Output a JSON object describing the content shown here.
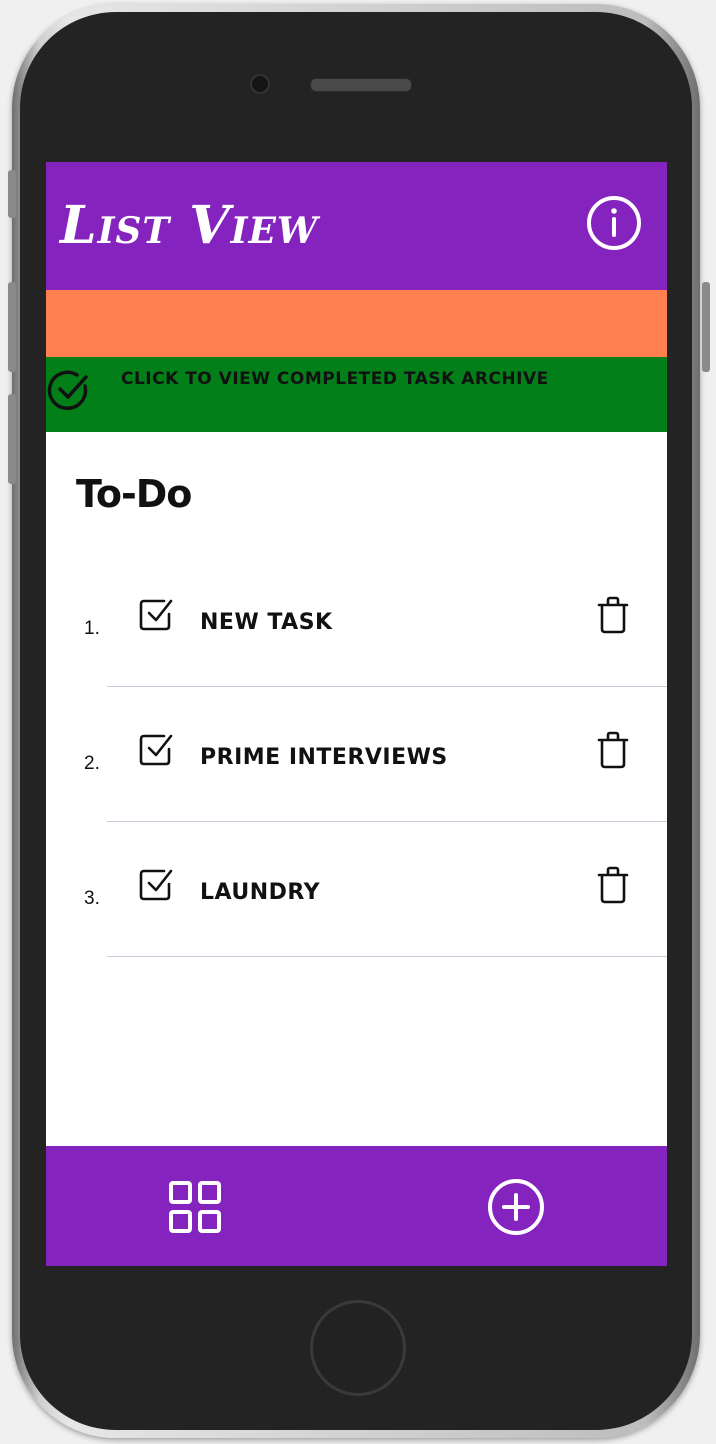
{
  "app": {
    "title": "List View",
    "archive_link": "CLICK TO VIEW COMPLETED TASK ARCHIVE",
    "section_title": "To-Do"
  },
  "tasks": [
    {
      "number": "1.",
      "label": "NEW TASK"
    },
    {
      "number": "2.",
      "label": "PRIME INTERVIEWS"
    },
    {
      "number": "3.",
      "label": "LAUNDRY"
    }
  ],
  "icons": {
    "header": "info-icon",
    "archive": "check-circle-icon",
    "task_check": "checkbox-checked-icon",
    "task_delete": "trash-icon",
    "nav_left": "grid-icon",
    "nav_right": "plus-circle-icon"
  },
  "colors": {
    "header": "#8523bf",
    "accent_bar": "#ff7f50",
    "archive_bar": "#027f18",
    "bottom_bar": "#8523bf",
    "divider": "#c6ccd8"
  }
}
